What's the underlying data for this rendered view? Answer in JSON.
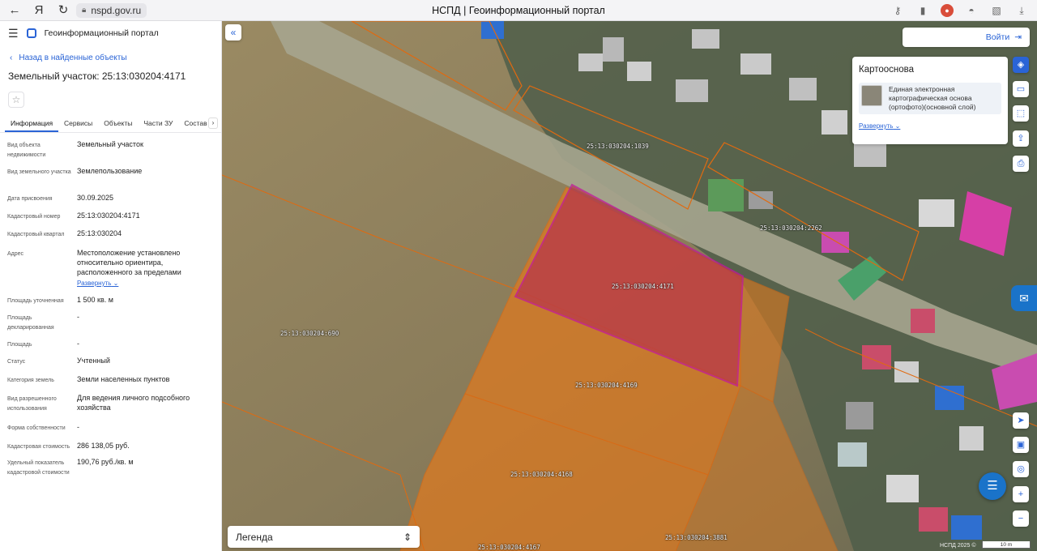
{
  "browser": {
    "url": "nspd.gov.ru",
    "title": "НСПД | Геоинформационный портал"
  },
  "panel": {
    "portal_name": "Геоинформационный портал",
    "back_link": "Назад в найденные объекты",
    "object_title": "Земельный участок: 25:13:030204:4171",
    "tabs": [
      "Информация",
      "Сервисы",
      "Объекты",
      "Части ЗУ",
      "Состав Е"
    ],
    "properties": [
      {
        "key": "Вид объекта недвижимости",
        "value": "Земельный участок"
      },
      {
        "key": "Вид земельного участка",
        "value": "Землепользование"
      },
      {
        "key": "Дата присвоения",
        "value": "30.09.2025"
      },
      {
        "key": "Кадастровый номер",
        "value": "25:13:030204:4171"
      },
      {
        "key": "Кадастровый квартал",
        "value": "25:13:030204"
      },
      {
        "key": "Адрес",
        "value": "Местоположение установлено относительно ориентира, расположенного за пределами",
        "expand": "Развернуть"
      },
      {
        "key": "Площадь уточненная",
        "value": "1 500 кв. м"
      },
      {
        "key": "Площадь декларированная",
        "value": "-"
      },
      {
        "key": "Площадь",
        "value": "-"
      },
      {
        "key": "Статус",
        "value": "Учтенный"
      },
      {
        "key": "Категория земель",
        "value": "Земли населенных пунктов"
      },
      {
        "key": "Вид разрешенного использования",
        "value": "Для ведения личного подсобного хозяйства"
      },
      {
        "key": "Форма собственности",
        "value": "-"
      },
      {
        "key": "Кадастровая стоимость",
        "value": "286 138,05 руб."
      },
      {
        "key": "Удельный показатель кадастровой стоимости",
        "value": "190,76 руб./кв. м"
      }
    ]
  },
  "map": {
    "login_label": "Войти",
    "basemap": {
      "title": "Картооснова",
      "layer": "Единая электронная картографическая основа (ортофото)(основной слой)",
      "expand": "Развернуть"
    },
    "parcels": [
      "25:13:030204:1039",
      "25:13:030204:2262",
      "25:13:030204:4171",
      "25:13:030204:690",
      "25:13:030204:4169",
      "25:13:030204:4168",
      "25:13:030204:3881",
      "25:13:030204:4167"
    ],
    "legend_label": "Легенда",
    "copyright": "НСПД 2025 ©",
    "scale": "10 m",
    "colors": {
      "parcel_fill": "#e07a1f",
      "selected_fill": "#b8384a",
      "selected_border": "#c2189a",
      "accent": "#2a64d6"
    }
  }
}
